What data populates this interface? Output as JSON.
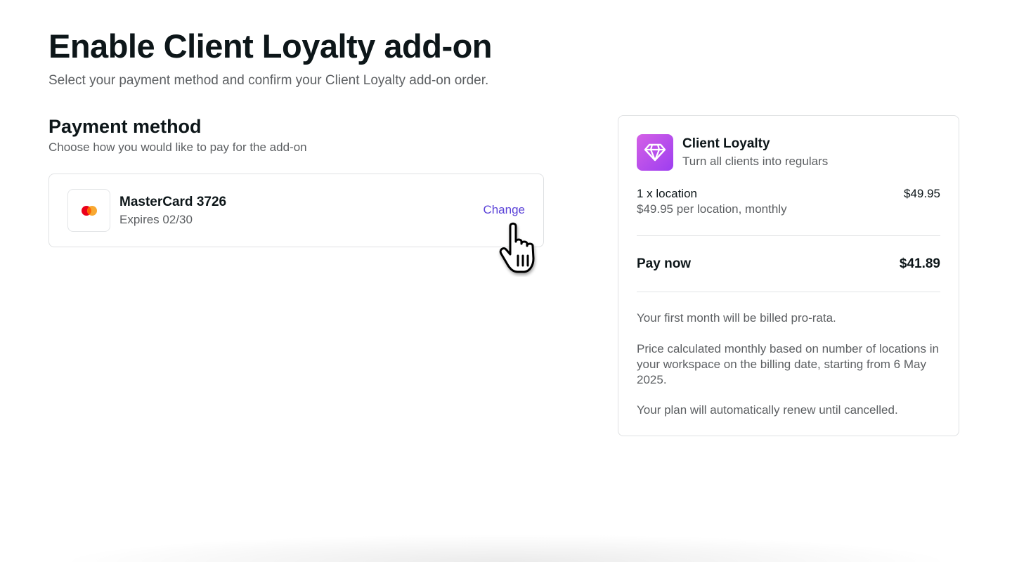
{
  "header": {
    "title": "Enable Client Loyalty add-on",
    "subtitle": "Select your payment method and confirm your Client Loyalty add-on order."
  },
  "payment": {
    "title": "Payment method",
    "subtitle": "Choose how you would like to pay for the add-on",
    "card": {
      "brand_icon": "mastercard-icon",
      "name": "MasterCard 3726",
      "expiry": "Expires 02/30",
      "change_label": "Change"
    }
  },
  "summary": {
    "addon": {
      "icon": "diamond-icon",
      "name": "Client Loyalty",
      "tagline": "Turn all clients into regulars"
    },
    "line_item": {
      "label": "1 x location",
      "detail": "$49.95 per location, monthly",
      "price": "$49.95"
    },
    "pay_now": {
      "label": "Pay now",
      "amount": "$41.89"
    },
    "notes": [
      "Your first month will be billed pro-rata.",
      "Price calculated monthly based on number of locations in your workspace on the billing date, starting from 6 May 2025.",
      "Your plan will automatically renew until cancelled."
    ]
  },
  "colors": {
    "link": "#5b43d8",
    "addon_gradient_start": "#d460e6",
    "addon_gradient_end": "#9d3ef0",
    "mastercard_red": "#eb001b",
    "mastercard_orange": "#f79e1b"
  }
}
